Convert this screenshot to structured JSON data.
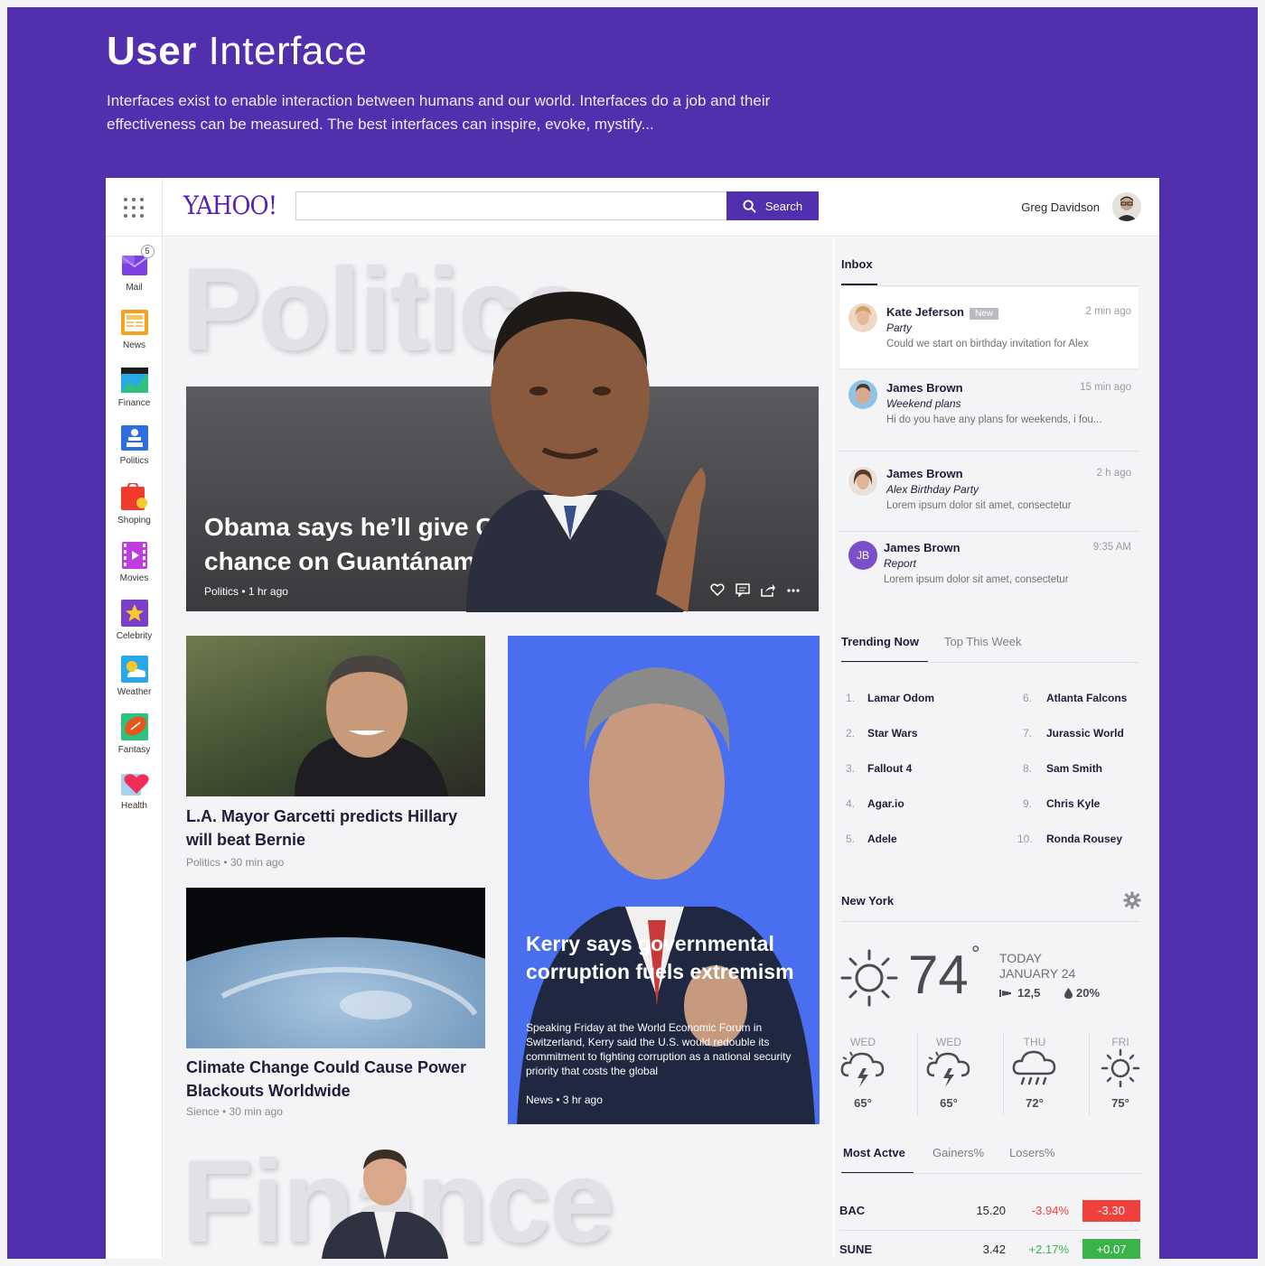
{
  "hero": {
    "title_bold": "User",
    "title_light": "Interface",
    "description": "Interfaces exist to enable interaction between humans and our world. Interfaces do a job and their effectiveness can be measured. The best interfaces can inspire, evoke, mystify..."
  },
  "header": {
    "logo": "YAHOO!",
    "search_placeholder": "",
    "search_label": "Search",
    "user_name": "Greg Davidson"
  },
  "sidebar": {
    "items": [
      {
        "label": "Mail",
        "icon": "mail-icon",
        "badge": "5"
      },
      {
        "label": "News",
        "icon": "news-icon"
      },
      {
        "label": "Finance",
        "icon": "finance-icon"
      },
      {
        "label": "Politics",
        "icon": "politics-icon"
      },
      {
        "label": "Shoping",
        "icon": "shopping-icon"
      },
      {
        "label": "Movies",
        "icon": "movies-icon"
      },
      {
        "label": "Celebrity",
        "icon": "celebrity-icon"
      },
      {
        "label": "Weather",
        "icon": "weather-icon"
      },
      {
        "label": "Fantasy",
        "icon": "fantasy-icon"
      },
      {
        "label": "Health",
        "icon": "health-icon"
      }
    ]
  },
  "main": {
    "section_politics": "Politics",
    "section_finance": "Finance",
    "feature": {
      "title": "Obama says he’ll give Congress last chance on Guantánamo",
      "meta": "Politics • 1 hr ago"
    },
    "cards": [
      {
        "title": "L.A. Mayor Garcetti predicts Hillary will beat Bernie",
        "meta": "Politics • 30 min ago"
      },
      {
        "title": "Climate Change Could Cause Power Blackouts Worldwide",
        "meta": "Sience • 30 min ago"
      }
    ],
    "kerry": {
      "title": "Kerry says governmental corruption fuels extremism",
      "text": "Speaking Friday at the World Economic Forum in Switzerland, Kerry said the U.S. would redouble its commitment to fighting corruption as a national security priority that costs the global",
      "meta": "News • 3 hr ago"
    }
  },
  "inbox": {
    "title": "Inbox",
    "messages": [
      {
        "from": "Kate Jeferson",
        "badge": "New",
        "subject": "Party",
        "preview": "Could we start on birthday invitation for Alex",
        "time": "2 min ago"
      },
      {
        "from": "James Brown",
        "subject": "Weekend plans",
        "preview": "Hi do you have any plans for weekends, i fou...",
        "time": "15 min ago"
      },
      {
        "from": "James Brown",
        "subject": "Alex Birthday Party",
        "preview": "Lorem ipsum dolor sit amet, consectetur",
        "time": "2 h ago"
      },
      {
        "from": "James Brown",
        "initials": "JB",
        "subject": "Report",
        "preview": "Lorem ipsum dolor sit amet, consectetur",
        "time": "9:35 AM"
      }
    ]
  },
  "trending": {
    "tab_active": "Trending Now",
    "tab_inactive": "Top This Week",
    "items": [
      {
        "num": "1.",
        "text": "Lamar Odom"
      },
      {
        "num": "2.",
        "text": "Star Wars"
      },
      {
        "num": "3.",
        "text": "Fallout 4"
      },
      {
        "num": "4.",
        "text": "Agar.io"
      },
      {
        "num": "5.",
        "text": "Adele"
      },
      {
        "num": "6.",
        "text": "Atlanta Falcons"
      },
      {
        "num": "7.",
        "text": "Jurassic World"
      },
      {
        "num": "8.",
        "text": "Sam Smith"
      },
      {
        "num": "9.",
        "text": "Chris Kyle"
      },
      {
        "num": "10.",
        "text": "Ronda Rousey"
      }
    ]
  },
  "weather": {
    "city": "New York",
    "temp": "74",
    "degree": "°",
    "today": "TODAY",
    "date": "JANUARY 24",
    "wind": "12,5",
    "precip": "20%",
    "forecast": [
      {
        "day": "WED",
        "temp": "65°",
        "icon": "storm-icon"
      },
      {
        "day": "WED",
        "temp": "65°",
        "icon": "storm-icon"
      },
      {
        "day": "THU",
        "temp": "72°",
        "icon": "rain-icon"
      },
      {
        "day": "FRI",
        "temp": "75°",
        "icon": "sun-icon"
      }
    ]
  },
  "stocks": {
    "tabs": [
      "Most Actve",
      "Gainers%",
      "Losers%"
    ],
    "rows": [
      {
        "symbol": "BAC",
        "price": "15.20",
        "pct": "-3.94%",
        "change": "-3.30",
        "color": "#f0413d"
      },
      {
        "symbol": "SUNE",
        "price": "3.42",
        "pct": "+2.17%",
        "change": "+0.07",
        "color": "#3ab44a"
      }
    ]
  },
  "colors": {
    "brand": "#522fad",
    "accent": "#5b1fb5",
    "negative": "#f0413d",
    "positive": "#3ab44a"
  }
}
